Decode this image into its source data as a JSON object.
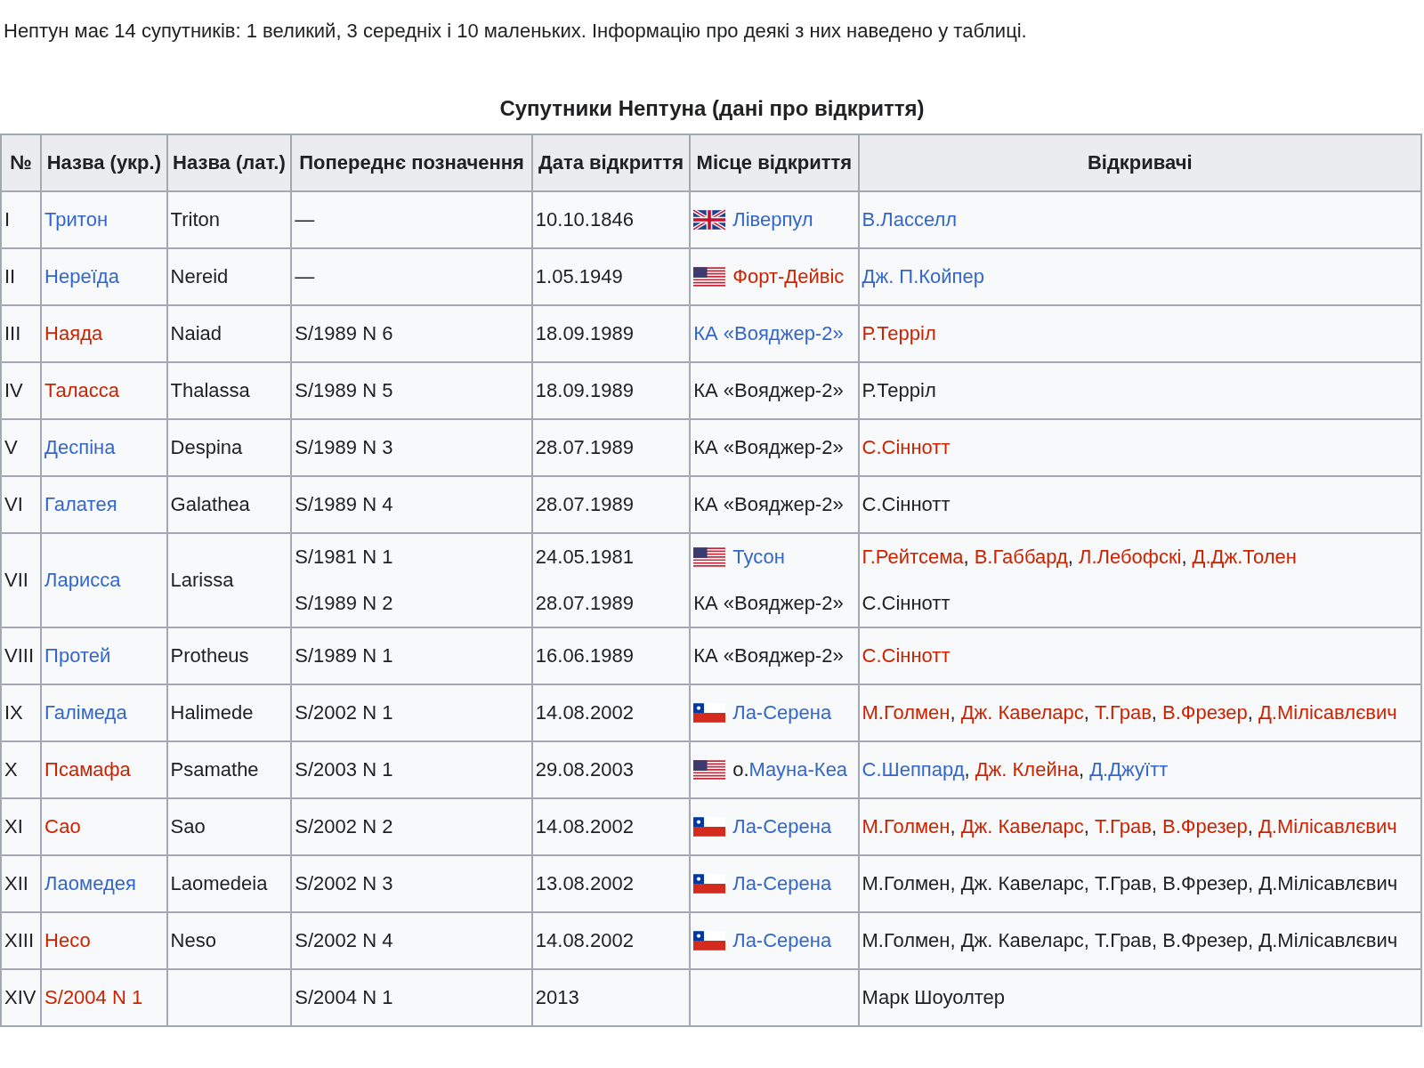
{
  "intro": "Нептун має 14 супутників: 1 великий, 3 середніх і 10 маленьких. Інформацію про деякі з них наведено у таблиці.",
  "table": {
    "caption": "Супутники Нептуна (дані про відкриття)",
    "columns": [
      "№",
      "Назва (укр.)",
      "Назва (лат.)",
      "Попереднє позначення",
      "Дата відкриття",
      "Місце відкриття",
      "Відкривачі"
    ],
    "rows": [
      {
        "number": "I",
        "name": {
          "text": "Тритон",
          "kind": "link"
        },
        "latin": "Triton",
        "designation": [
          "—"
        ],
        "date": [
          "10.10.1846"
        ],
        "place": [
          {
            "kind": "uk",
            "parts": [
              {
                "text": "Ліверпул",
                "kind": "link"
              }
            ]
          }
        ],
        "discoverers": [
          [
            {
              "text": "В.Ласселл",
              "kind": "link"
            }
          ]
        ]
      },
      {
        "number": "II",
        "name": {
          "text": "Нереїда",
          "kind": "link"
        },
        "latin": "Nereid",
        "designation": [
          "—"
        ],
        "date": [
          "1.05.1949"
        ],
        "place": [
          {
            "kind": "us",
            "parts": [
              {
                "text": "Форт-Дейвіс",
                "kind": "redlink"
              }
            ]
          }
        ],
        "discoverers": [
          [
            {
              "text": "Дж. П.Койпер",
              "kind": "link"
            }
          ]
        ]
      },
      {
        "number": "III",
        "name": {
          "text": "Наяда",
          "kind": "redlink"
        },
        "latin": "Naiad",
        "designation": [
          "S/1989 N 6"
        ],
        "date": [
          "18.09.1989"
        ],
        "place": [
          {
            "kind": "text",
            "parts": [
              {
                "text": "КА «Вояджер-2»",
                "kind": "link"
              }
            ]
          }
        ],
        "discoverers": [
          [
            {
              "text": "Р.Терріл",
              "kind": "redlink"
            }
          ]
        ]
      },
      {
        "number": "IV",
        "name": {
          "text": "Таласса",
          "kind": "redlink"
        },
        "latin": "Thalassa",
        "designation": [
          "S/1989 N 5"
        ],
        "date": [
          "18.09.1989"
        ],
        "place": [
          {
            "kind": "text",
            "parts": [
              {
                "text": "КА «Вояджер-2»",
                "kind": "plain"
              }
            ]
          }
        ],
        "discoverers": [
          [
            {
              "text": "Р.Терріл",
              "kind": "plain"
            }
          ]
        ]
      },
      {
        "number": "V",
        "name": {
          "text": "Деспіна",
          "kind": "link"
        },
        "latin": "Despina",
        "designation": [
          "S/1989 N 3"
        ],
        "date": [
          "28.07.1989"
        ],
        "place": [
          {
            "kind": "text",
            "parts": [
              {
                "text": "КА «Вояджер-2»",
                "kind": "plain"
              }
            ]
          }
        ],
        "discoverers": [
          [
            {
              "text": "С.Сіннотт",
              "kind": "redlink"
            }
          ]
        ]
      },
      {
        "number": "VI",
        "name": {
          "text": "Галатея",
          "kind": "link"
        },
        "latin": "Galathea",
        "designation": [
          "S/1989 N 4"
        ],
        "date": [
          "28.07.1989"
        ],
        "place": [
          {
            "kind": "text",
            "parts": [
              {
                "text": "КА «Вояджер-2»",
                "kind": "plain"
              }
            ]
          }
        ],
        "discoverers": [
          [
            {
              "text": "С.Сіннотт",
              "kind": "plain"
            }
          ]
        ]
      },
      {
        "number": "VII",
        "name": {
          "text": "Ларисса",
          "kind": "link"
        },
        "latin": "Larissa",
        "designation": [
          "S/1981 N 1",
          "S/1989 N 2"
        ],
        "date": [
          "24.05.1981",
          "28.07.1989"
        ],
        "place": [
          {
            "kind": "us",
            "parts": [
              {
                "text": "Тусон",
                "kind": "link"
              }
            ]
          },
          {
            "kind": "text",
            "parts": [
              {
                "text": "КА «Вояджер-2»",
                "kind": "plain"
              }
            ]
          }
        ],
        "discoverers": [
          [
            {
              "text": "Г.Рейтсема",
              "kind": "redlink"
            },
            {
              "text": ",",
              "kind": "plain"
            },
            {
              "text": "В.Габбард",
              "kind": "redlink"
            },
            {
              "text": ",",
              "kind": "plain"
            },
            {
              "text": "Л.Лебофскі",
              "kind": "redlink"
            },
            {
              "text": ",",
              "kind": "plain"
            },
            {
              "text": "Д.Дж.Толен",
              "kind": "redlink"
            }
          ],
          [
            {
              "text": "С.Сіннотт",
              "kind": "plain"
            }
          ]
        ]
      },
      {
        "number": "VIII",
        "name": {
          "text": "Протей",
          "kind": "link"
        },
        "latin": "Protheus",
        "designation": [
          "S/1989 N 1"
        ],
        "date": [
          "16.06.1989"
        ],
        "place": [
          {
            "kind": "text",
            "parts": [
              {
                "text": "КА «Вояджер-2»",
                "kind": "plain"
              }
            ]
          }
        ],
        "discoverers": [
          [
            {
              "text": "С.Сіннотт",
              "kind": "redlink"
            }
          ]
        ]
      },
      {
        "number": "IX",
        "name": {
          "text": "Галімеда",
          "kind": "link"
        },
        "latin": "Halimede",
        "designation": [
          "S/2002 N 1"
        ],
        "date": [
          "14.08.2002"
        ],
        "place": [
          {
            "kind": "chile",
            "parts": [
              {
                "text": "Ла-Серена",
                "kind": "link"
              }
            ]
          }
        ],
        "discoverers": [
          [
            {
              "text": "М.Голмен",
              "kind": "redlink"
            },
            {
              "text": ",",
              "kind": "plain"
            },
            {
              "text": "Дж. Кавеларс",
              "kind": "redlink"
            },
            {
              "text": ",",
              "kind": "plain"
            },
            {
              "text": "Т.Грав",
              "kind": "redlink"
            },
            {
              "text": ",",
              "kind": "plain"
            },
            {
              "text": "В.Фрезер",
              "kind": "redlink"
            },
            {
              "text": ",",
              "kind": "plain"
            },
            {
              "text": "Д.Мілісавлєвич",
              "kind": "redlink"
            }
          ]
        ]
      },
      {
        "number": "X",
        "name": {
          "text": "Псамафа",
          "kind": "redlink"
        },
        "latin": "Psamathe",
        "designation": [
          "S/2003 N 1"
        ],
        "date": [
          "29.08.2003"
        ],
        "place": [
          {
            "kind": "us",
            "parts": [
              {
                "text": "о.",
                "kind": "plain"
              },
              {
                "text": "Мауна-Кеа",
                "kind": "link"
              }
            ]
          }
        ],
        "discoverers": [
          [
            {
              "text": "С.Шеппард",
              "kind": "link"
            },
            {
              "text": ",",
              "kind": "plain"
            },
            {
              "text": "Дж. Клейна",
              "kind": "redlink"
            },
            {
              "text": ",",
              "kind": "plain"
            },
            {
              "text": "Д.Джуїтт",
              "kind": "link"
            }
          ]
        ]
      },
      {
        "number": "XI",
        "name": {
          "text": "Сао",
          "kind": "redlink"
        },
        "latin": "Sao",
        "designation": [
          "S/2002 N 2"
        ],
        "date": [
          "14.08.2002"
        ],
        "place": [
          {
            "kind": "chile",
            "parts": [
              {
                "text": "Ла-Серена",
                "kind": "link"
              }
            ]
          }
        ],
        "discoverers": [
          [
            {
              "text": "М.Голмен",
              "kind": "redlink"
            },
            {
              "text": ",",
              "kind": "plain"
            },
            {
              "text": "Дж. Кавеларс",
              "kind": "redlink"
            },
            {
              "text": ",",
              "kind": "plain"
            },
            {
              "text": "Т.Грав",
              "kind": "redlink"
            },
            {
              "text": ",",
              "kind": "plain"
            },
            {
              "text": "В.Фрезер",
              "kind": "redlink"
            },
            {
              "text": ",",
              "kind": "plain"
            },
            {
              "text": "Д.Мілісавлєвич",
              "kind": "redlink"
            }
          ]
        ]
      },
      {
        "number": "XII",
        "name": {
          "text": "Лаомедея",
          "kind": "link"
        },
        "latin": "Laomedeia",
        "designation": [
          "S/2002 N 3"
        ],
        "date": [
          "13.08.2002"
        ],
        "place": [
          {
            "kind": "chile",
            "parts": [
              {
                "text": "Ла-Серена",
                "kind": "link"
              }
            ]
          }
        ],
        "discoverers": [
          [
            {
              "text": "М.Голмен, Дж. Кавеларс, Т.Грав, В.Фрезер, Д.Мілісавлєвич",
              "kind": "plain"
            }
          ]
        ]
      },
      {
        "number": "XIII",
        "name": {
          "text": "Несо",
          "kind": "redlink"
        },
        "latin": "Neso",
        "designation": [
          "S/2002 N 4"
        ],
        "date": [
          "14.08.2002"
        ],
        "place": [
          {
            "kind": "chile",
            "parts": [
              {
                "text": "Ла-Серена",
                "kind": "link"
              }
            ]
          }
        ],
        "discoverers": [
          [
            {
              "text": "М.Голмен, Дж. Кавеларс, Т.Грав, В.Фрезер, Д.Мілісавлєвич",
              "kind": "plain"
            }
          ]
        ]
      },
      {
        "number": "XIV",
        "name": {
          "text": "S/2004 N 1",
          "kind": "redlink"
        },
        "designation": [
          "S/2004 N 1"
        ],
        "date": [
          "2013"
        ],
        "place": [],
        "discoverers": [
          [
            {
              "text": "Марк Шоуолтер",
              "kind": "plain"
            }
          ]
        ]
      }
    ]
  }
}
